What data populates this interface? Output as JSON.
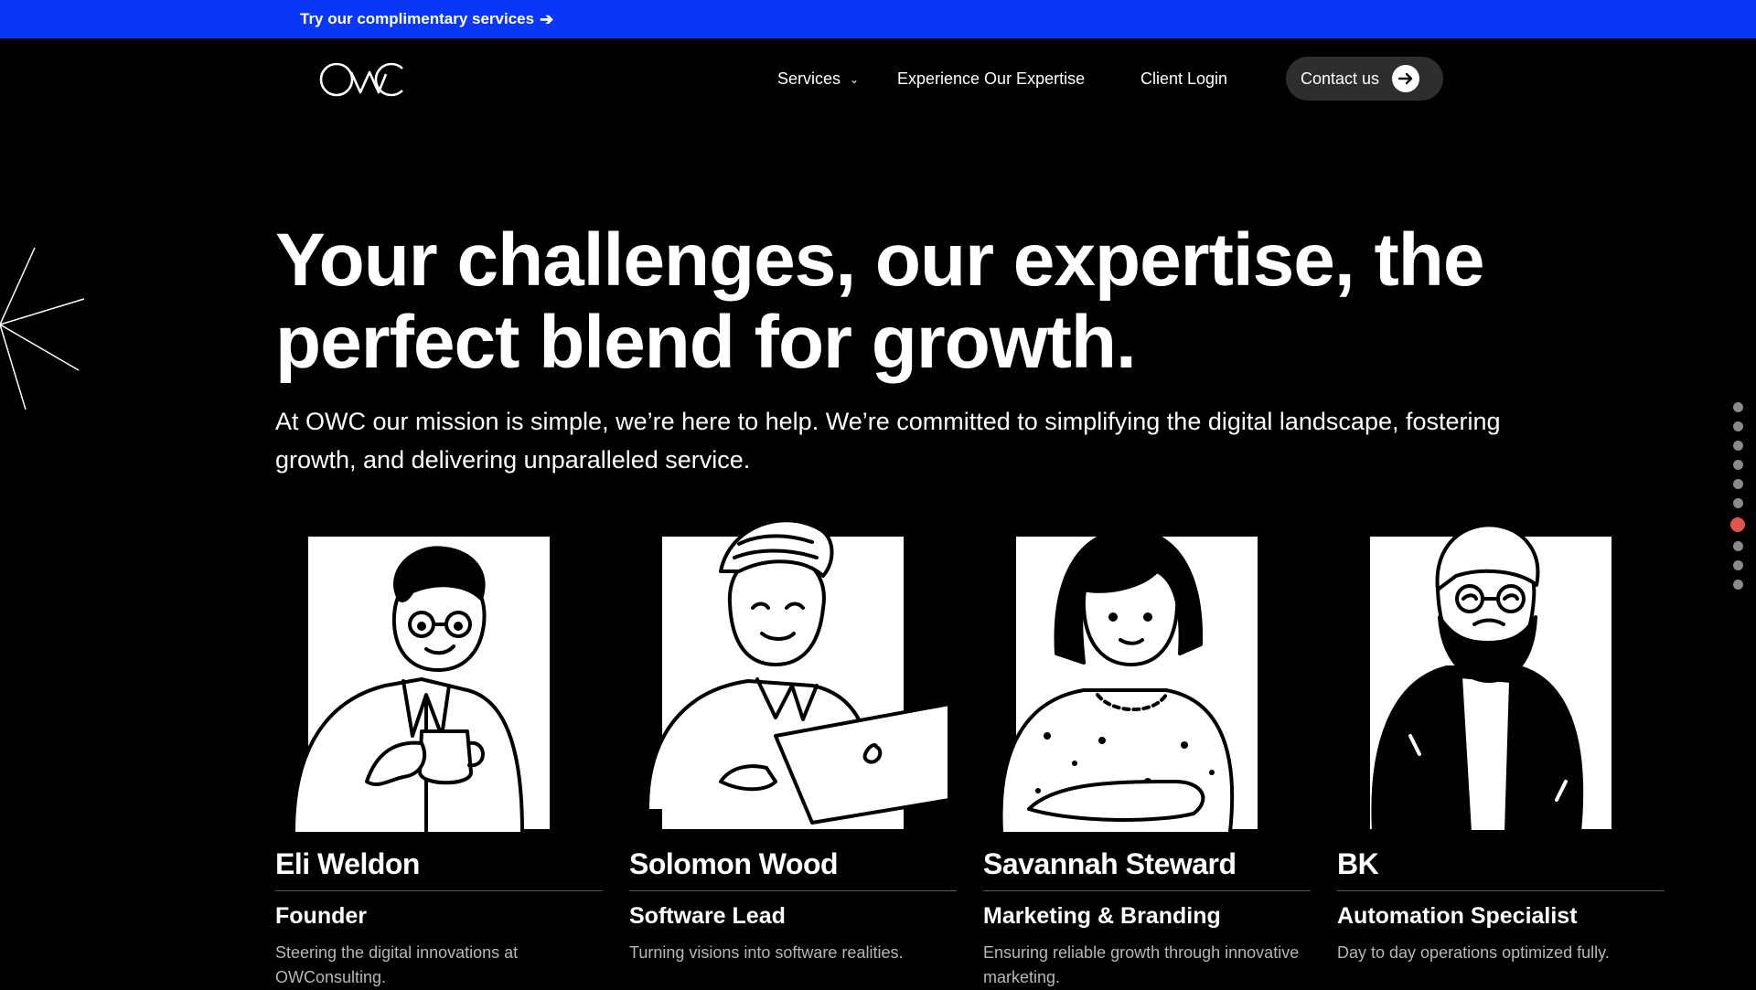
{
  "promo": {
    "text": "Try our complimentary services",
    "arrow_icon": "arrow-right-icon",
    "bar_color": "#0a36f5"
  },
  "brand": {
    "logo_text": "OWC"
  },
  "nav": {
    "services_label": "Services",
    "expertise_label": "Experience Our Expertise",
    "login_label": "Client Login",
    "contact_label": "Contact us"
  },
  "hero": {
    "title": "Your challenges, our expertise, the perfect blend for growth.",
    "subtitle": "At OWC our mission is simple, we’re here to help. We’re committed to simplifying the digital landscape, fostering growth, and delivering unparalleled service."
  },
  "section_nav": {
    "total": 10,
    "active_index": 6,
    "active_color": "#e0544e"
  },
  "team": [
    {
      "name": "Eli Weldon",
      "role": "Founder",
      "description": "Steering the digital innovations at OWConsulting."
    },
    {
      "name": "Solomon Wood",
      "role": "Software Lead",
      "description": "Turning visions into software realities."
    },
    {
      "name": "Savannah Steward",
      "role": "Marketing & Branding",
      "description": "Ensuring reliable growth through innovative marketing."
    },
    {
      "name": "BK",
      "role": "Automation Specialist",
      "description": "Day to day operations optimized fully."
    }
  ]
}
